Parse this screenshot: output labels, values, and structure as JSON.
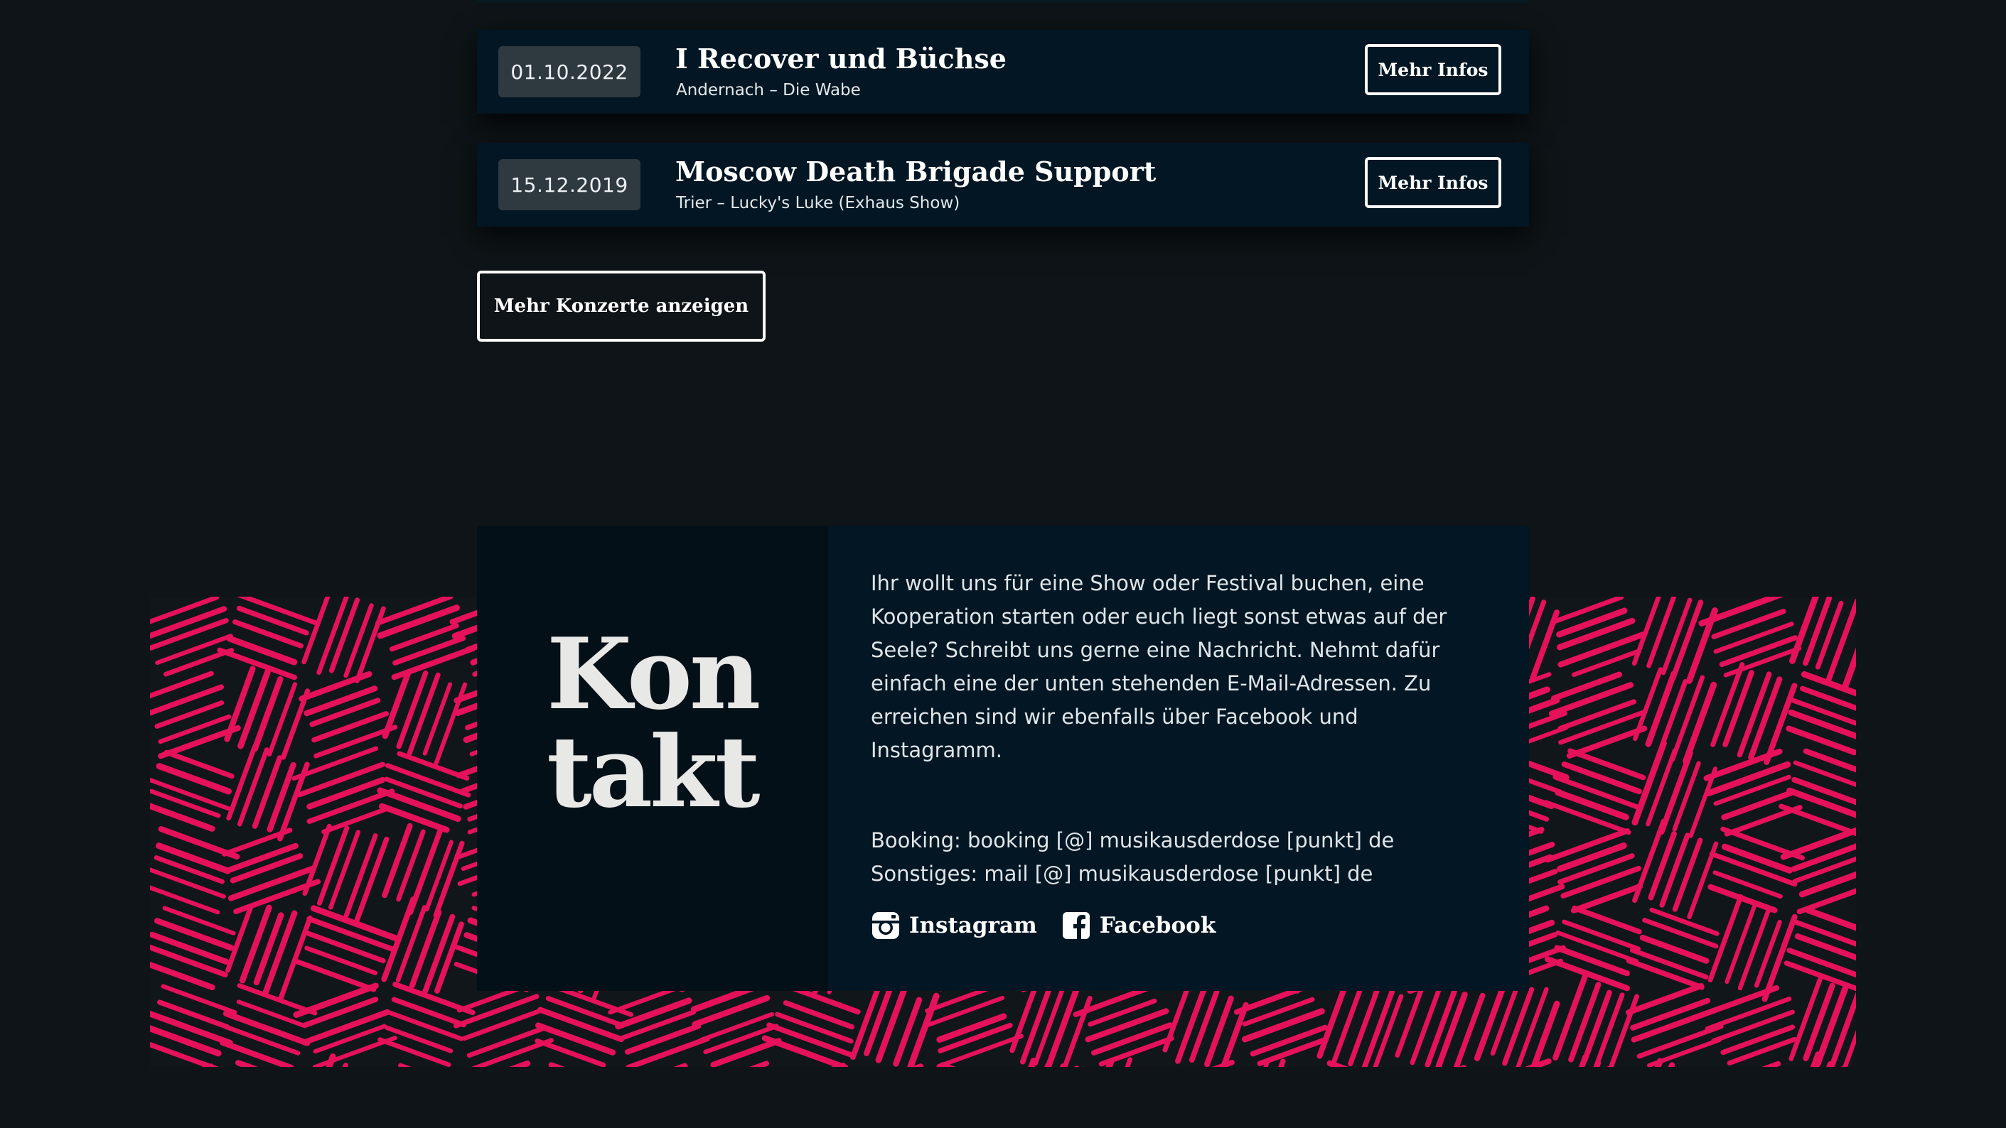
{
  "concerts": [
    {
      "date": "01.10.2022",
      "title": "I Recover und Büchse",
      "venue": "Andernach – Die Wabe",
      "button_label": "Mehr Infos"
    },
    {
      "date": "15.12.2019",
      "title": "Moscow Death Brigade Support",
      "venue": "Trier – Lucky's Luke (Exhaus Show)",
      "button_label": "Mehr Infos"
    }
  ],
  "more_concerts_label": "Mehr Konzerte anzeigen",
  "contact": {
    "title_line1": "Kon",
    "title_line2": "takt",
    "text": "Ihr wollt uns für eine Show oder Festival buchen, eine Kooperation starten oder euch liegt sonst etwas auf der Seele? Schreibt uns gerne eine Nachricht. Nehmt dafür einfach eine der unten stehenden E-Mail-Adressen. Zu erreichen sind wir ebenfalls über Facebook und Instagramm.",
    "booking": "Booking: booking [@] musikausderdose [punkt] de",
    "other": "Sonstiges: mail [@] musikausderdose [punkt] de",
    "socials": [
      {
        "label": "Instagram",
        "icon": "instagram-icon"
      },
      {
        "label": "Facebook",
        "icon": "facebook-icon"
      }
    ]
  },
  "colors": {
    "background": "#0e1417",
    "card": "#021624",
    "pattern_accent": "#e5115a",
    "date_badge": "#2f3940"
  }
}
